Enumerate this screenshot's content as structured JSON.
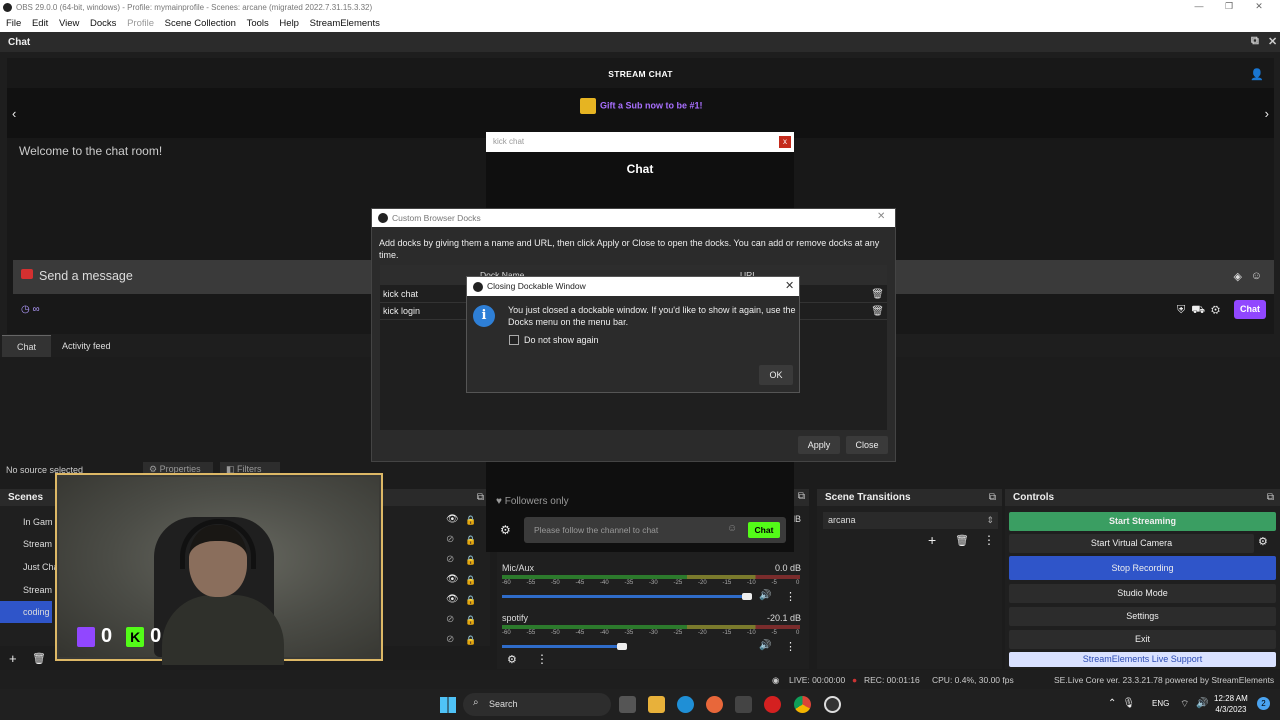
{
  "window": {
    "title": "OBS 29.0.0 (64-bit, windows) - Profile: mymainprofile - Scenes: arcane (migrated 2022.7.31.15.3.32)"
  },
  "menu": [
    "File",
    "Edit",
    "View",
    "Docks",
    "Profile",
    "Scene Collection",
    "Tools",
    "Help",
    "StreamElements"
  ],
  "chat_dock": {
    "title": "Chat",
    "header": "STREAM CHAT",
    "gift_text": "Gift a Sub now to be #1!",
    "welcome": "Welcome to the chat room!",
    "send_placeholder": "Send a message",
    "timer": "∞",
    "chat_button": "Chat"
  },
  "tabs": [
    "Chat",
    "Activity feed"
  ],
  "source_bar": {
    "no_source": "No source selected",
    "properties": "Properties",
    "filters": "Filters"
  },
  "scenes": {
    "title": "Scenes",
    "items": [
      "In Gam",
      "Stream",
      "Just Cha",
      "Stream",
      "coding"
    ],
    "selected_index": 4
  },
  "webcam_overlay": {
    "twitch_count": "0",
    "kick_count": "0"
  },
  "audio_mixer": {
    "top_db": "dB",
    "channels": [
      {
        "name": "Mic/Aux",
        "db": "0.0 dB",
        "volume": 0.99
      },
      {
        "name": "spotify",
        "db": "-20.1 dB",
        "volume": 0.49
      }
    ],
    "scale": [
      "-60",
      "-55",
      "-50",
      "-45",
      "-40",
      "-35",
      "-30",
      "-25",
      "-20",
      "-15",
      "-10",
      "-5",
      "0"
    ]
  },
  "scene_transitions": {
    "title": "Scene Transitions",
    "selected": "arcana"
  },
  "controls": {
    "title": "Controls",
    "buttons": [
      "Start Streaming",
      "Start Virtual Camera",
      "Stop Recording",
      "Studio Mode",
      "Settings",
      "Exit",
      "StreamElements Live Support"
    ]
  },
  "kick_popup": {
    "title": "kick chat",
    "close": "x",
    "heading": "Chat",
    "followers": "Followers only",
    "placeholder": "Please follow the channel to chat",
    "chat_button": "Chat"
  },
  "custom_docks": {
    "title": "Custom Browser Docks",
    "description": "Add docks by giving them a name and URL, then click Apply or Close to open the docks. You can add or remove docks at any time.",
    "columns": [
      "Dock Name",
      "URL"
    ],
    "rows": [
      "kick chat",
      "kick login"
    ],
    "apply": "Apply",
    "close": "Close"
  },
  "modal": {
    "title": "Closing Dockable Window",
    "message": "You just closed a dockable window. If you'd like to show it again, use the Docks menu on the menu bar.",
    "checkbox_label": "Do not show again",
    "ok": "OK"
  },
  "status": {
    "live": "LIVE: 00:00:00",
    "rec": "REC: 00:01:16",
    "cpu": "CPU: 0.4%, 30.00 fps",
    "se": "SE.Live Core ver. 23.3.21.78 powered by StreamElements"
  },
  "taskbar": {
    "search": "Search",
    "lang": "ENG",
    "time": "12:28 AM",
    "date": "4/3/2023"
  },
  "colors": {
    "accent_purple": "#9147ff",
    "kick_green": "#53fc18",
    "start_stream": "#3a9e62",
    "stop_record": "#2f55c9"
  }
}
